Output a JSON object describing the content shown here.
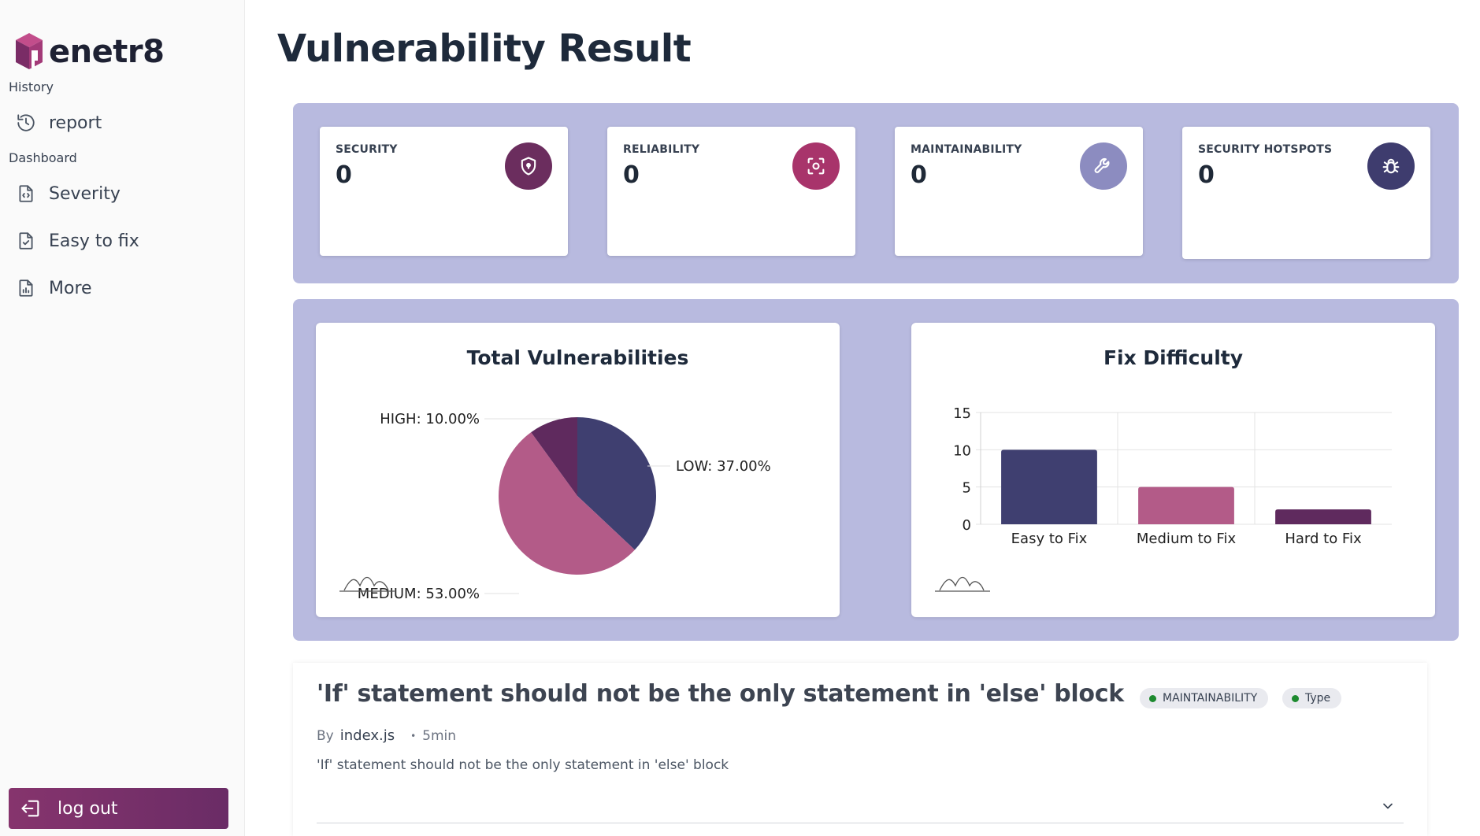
{
  "sidebar": {
    "brand": "enetr8",
    "history_label": "History",
    "dashboard_label": "Dashboard",
    "items": [
      {
        "label": "report",
        "icon": "history-icon"
      },
      {
        "label": "Severity",
        "icon": "file-code-icon"
      },
      {
        "label": "Easy to fix",
        "icon": "file-check-icon"
      },
      {
        "label": "More",
        "icon": "file-chart-icon"
      }
    ],
    "logout_label": "log out"
  },
  "page": {
    "title": "Vulnerability Result"
  },
  "metrics": [
    {
      "label": "SECURITY",
      "value": "0",
      "icon": "shield-icon",
      "color": "#6b2d5e"
    },
    {
      "label": "RELIABILITY",
      "value": "0",
      "icon": "focus-scan-icon",
      "color": "#a8346b"
    },
    {
      "label": "MAINTAINABILITY",
      "value": "0",
      "icon": "wrench-icon",
      "color": "#8c8cc0"
    },
    {
      "label": "SECURITY HOTSPOTS",
      "value": "0",
      "icon": "bug-icon",
      "color": "#3e3c6e"
    }
  ],
  "chart_data": [
    {
      "type": "pie",
      "title": "Total Vulnerabilities",
      "slices": [
        {
          "label": "LOW",
          "value": 37.0,
          "display": "LOW: 37.00%",
          "color": "#3f3f70"
        },
        {
          "label": "MEDIUM",
          "value": 53.0,
          "display": "MEDIUM: 53.00%",
          "color": "#b35b88"
        },
        {
          "label": "HIGH",
          "value": 10.0,
          "display": "HIGH: 10.00%",
          "color": "#5f2a5e"
        }
      ]
    },
    {
      "type": "bar",
      "title": "Fix Difficulty",
      "categories": [
        "Easy to Fix",
        "Medium to Fix",
        "Hard to Fix"
      ],
      "values": [
        10,
        5,
        2
      ],
      "colors": [
        "#3f3f70",
        "#b35b88",
        "#5f2a5e"
      ],
      "ylim": [
        0,
        15
      ],
      "yticks": [
        0,
        5,
        10,
        15
      ],
      "grid": true
    }
  ],
  "issue": {
    "title": "'If' statement should not be the only statement in 'else' block",
    "tags": [
      "MAINTAINABILITY",
      "Type"
    ],
    "by_label": "By",
    "file": "index.js",
    "time": "5min",
    "description": "'If' statement should not be the only statement in 'else' block"
  }
}
